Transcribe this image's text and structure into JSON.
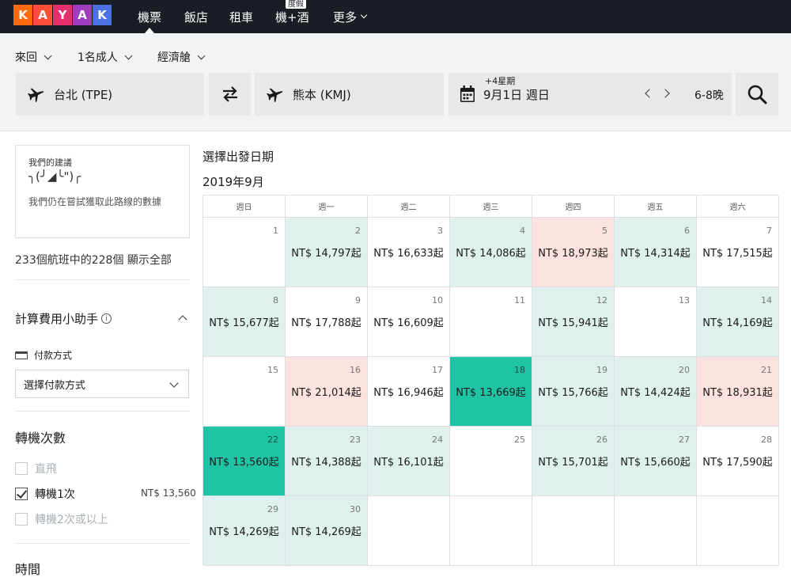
{
  "nav": {
    "logo_letters": [
      "K",
      "A",
      "Y",
      "A",
      "K"
    ],
    "logo_colors": [
      "#ff690f",
      "#ff4f3a",
      "#e62e6b",
      "#a03ec2",
      "#4b70e0"
    ],
    "links": [
      {
        "label": "機票",
        "active": true
      },
      {
        "label": "飯店",
        "active": false
      },
      {
        "label": "租車",
        "active": false
      },
      {
        "label": "機+酒",
        "active": false
      },
      {
        "label": "更多",
        "active": false
      }
    ],
    "holiday_badge": "度假"
  },
  "options": {
    "trip_type": "來回",
    "travelers": "1名成人",
    "cabin": "經濟艙"
  },
  "search": {
    "origin": "台北 (TPE)",
    "destination": "熊本 (KMJ)",
    "plus_weeks": "+4星期",
    "date": "9月1日 週日",
    "nights": "6-8晚",
    "icons": {
      "origin": "plane-icon",
      "swap": "swap-icon",
      "destination": "plane-icon",
      "date": "calendar-icon",
      "search": "search-icon"
    }
  },
  "sidebar": {
    "suggest_title": "我們的建議",
    "suggest_kaomoji": "╮(╯◢╰\")╭",
    "suggest_msg": "我們仍在嘗試獲取此路線的數據",
    "count_line": "233個航班中的228個 顯示全部",
    "calc_title": "計算費用小助手",
    "pay_label": "付款方式",
    "pay_select": "選擇付款方式",
    "stops_title": "轉機次數",
    "stops": [
      {
        "label": "直飛",
        "checked": false,
        "disabled": true
      },
      {
        "label": "轉機1次",
        "checked": true,
        "disabled": false,
        "price": "NT$ 13,560"
      },
      {
        "label": "轉機2次或以上",
        "checked": false,
        "disabled": true
      }
    ],
    "time_title": "時間"
  },
  "calendar": {
    "heading": "選擇出發日期",
    "month": "2019年9月",
    "weekdays": [
      "週日",
      "週一",
      "週二",
      "週三",
      "週四",
      "週五",
      "週六"
    ],
    "weeks": [
      [
        {
          "day": "1",
          "price": "",
          "tone": "w"
        },
        {
          "day": "2",
          "price": "NT$ 14,797起",
          "tone": "g"
        },
        {
          "day": "3",
          "price": "NT$ 16,633起",
          "tone": "w"
        },
        {
          "day": "4",
          "price": "NT$ 14,086起",
          "tone": "g"
        },
        {
          "day": "5",
          "price": "NT$ 18,973起",
          "tone": "r"
        },
        {
          "day": "6",
          "price": "NT$ 14,314起",
          "tone": "g"
        },
        {
          "day": "7",
          "price": "NT$ 17,515起",
          "tone": "w"
        }
      ],
      [
        {
          "day": "8",
          "price": "NT$ 15,677起",
          "tone": "g"
        },
        {
          "day": "9",
          "price": "NT$ 17,788起",
          "tone": "w"
        },
        {
          "day": "10",
          "price": "NT$ 16,609起",
          "tone": "w"
        },
        {
          "day": "11",
          "price": "",
          "tone": "w"
        },
        {
          "day": "12",
          "price": "NT$ 15,941起",
          "tone": "g"
        },
        {
          "day": "13",
          "price": "",
          "tone": "w"
        },
        {
          "day": "14",
          "price": "NT$ 14,169起",
          "tone": "g"
        }
      ],
      [
        {
          "day": "15",
          "price": "",
          "tone": "w"
        },
        {
          "day": "16",
          "price": "NT$ 21,014起",
          "tone": "r"
        },
        {
          "day": "17",
          "price": "NT$ 16,946起",
          "tone": "w"
        },
        {
          "day": "18",
          "price": "NT$ 13,669起",
          "tone": "t"
        },
        {
          "day": "19",
          "price": "NT$ 15,766起",
          "tone": "g"
        },
        {
          "day": "20",
          "price": "NT$ 14,424起",
          "tone": "g"
        },
        {
          "day": "21",
          "price": "NT$ 18,931起",
          "tone": "r"
        }
      ],
      [
        {
          "day": "22",
          "price": "NT$ 13,560起",
          "tone": "t"
        },
        {
          "day": "23",
          "price": "NT$ 14,388起",
          "tone": "g"
        },
        {
          "day": "24",
          "price": "NT$ 16,101起",
          "tone": "g"
        },
        {
          "day": "25",
          "price": "",
          "tone": "w"
        },
        {
          "day": "26",
          "price": "NT$ 15,701起",
          "tone": "g"
        },
        {
          "day": "27",
          "price": "NT$ 15,660起",
          "tone": "g"
        },
        {
          "day": "28",
          "price": "NT$ 17,590起",
          "tone": "w"
        }
      ],
      [
        {
          "day": "29",
          "price": "NT$ 14,269起",
          "tone": "g"
        },
        {
          "day": "30",
          "price": "NT$ 14,269起",
          "tone": "g"
        },
        {
          "day": "",
          "price": "",
          "tone": "e"
        },
        {
          "day": "",
          "price": "",
          "tone": "e"
        },
        {
          "day": "",
          "price": "",
          "tone": "e"
        },
        {
          "day": "",
          "price": "",
          "tone": "e"
        },
        {
          "day": "",
          "price": "",
          "tone": "e"
        }
      ]
    ]
  }
}
